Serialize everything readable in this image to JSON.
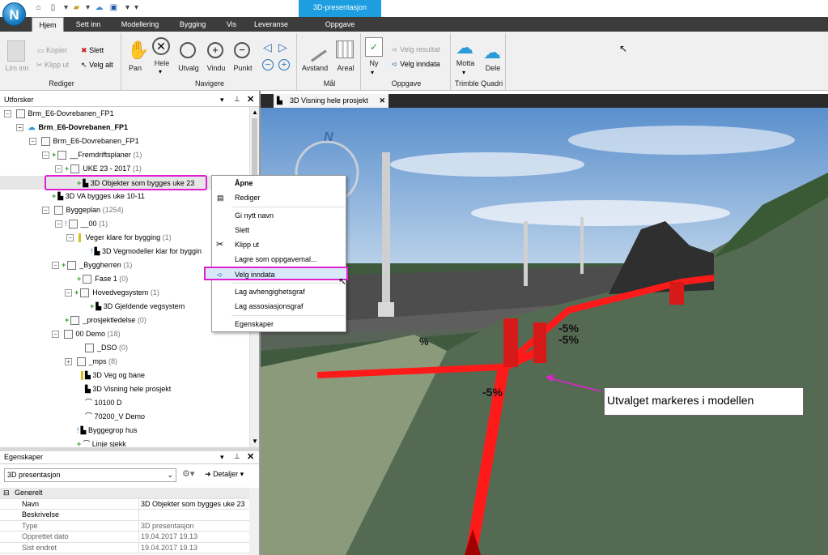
{
  "app": {
    "logo_letter": "N",
    "context_tab": "3D-presentasjon"
  },
  "tabs": [
    "Hjem",
    "Sett inn",
    "Modellering",
    "Bygging",
    "Vis",
    "Leveranse",
    "Oppgave"
  ],
  "ribbon": {
    "rediger": {
      "label": "Rediger",
      "lim_inn": "Lim inn",
      "kopier": "Kopier",
      "klipp_ut": "Klipp ut",
      "slett": "Slett",
      "velg_alt": "Velg alt"
    },
    "navigere": {
      "label": "Navigere",
      "pan": "Pan",
      "hele": "Hele",
      "utvalg": "Utvalg",
      "vindu": "Vindu",
      "punkt": "Punkt"
    },
    "maal": {
      "label": "Mål",
      "avstand": "Avstand",
      "areal": "Areal"
    },
    "oppgave": {
      "label": "Oppgave",
      "ny": "Ny",
      "velg_resultat": "Velg resultat",
      "velg_inndata": "Velg inndata"
    },
    "trimble": {
      "label": "Trimble Quadri",
      "motta": "Motta",
      "dele": "Dele"
    }
  },
  "explorer": {
    "title": "Utforsker",
    "items": [
      {
        "label": "Brm_E6-Dovrebanen_FP1",
        "count": ""
      },
      {
        "label": "Brm_E6-Dovrebanen_FP1",
        "count": ""
      },
      {
        "label": "Brm_E6-Dovrebanen_FP1",
        "count": ""
      },
      {
        "label": "__Fremdriftsplaner",
        "count": "(1)"
      },
      {
        "label": "UKE 23 - 2017",
        "count": "(1)"
      },
      {
        "label": "3D Objekter som bygges uke 23",
        "count": ""
      },
      {
        "label": "3D VA bygges uke 10-11",
        "count": ""
      },
      {
        "label": "Byggeplan",
        "count": "(1254)"
      },
      {
        "label": "__00",
        "count": "(1)"
      },
      {
        "label": "Veger klare for bygging",
        "count": "(1)"
      },
      {
        "label": "3D Vegmodeller klar for byggin",
        "count": ""
      },
      {
        "label": "_Byggherren",
        "count": "(1)"
      },
      {
        "label": "Fase 1",
        "count": "(0)"
      },
      {
        "label": "Hovedvegsystem",
        "count": "(1)"
      },
      {
        "label": "3D Gjeldende vegsystem",
        "count": ""
      },
      {
        "label": "_prosjektledelse",
        "count": "(0)"
      },
      {
        "label": "00 Demo",
        "count": "(18)"
      },
      {
        "label": "_DSO",
        "count": "(0)"
      },
      {
        "label": "_mps",
        "count": "(8)"
      },
      {
        "label": "3D Veg og bane",
        "count": ""
      },
      {
        "label": "3D Visning hele prosjekt",
        "count": ""
      },
      {
        "label": "10100 D",
        "count": ""
      },
      {
        "label": "70200_V Demo",
        "count": ""
      },
      {
        "label": "Byggegrop hus",
        "count": ""
      },
      {
        "label": "Linje sjekk",
        "count": ""
      }
    ]
  },
  "properties": {
    "title": "Egenskaper",
    "selected": "3D presentasjon",
    "details_label": "Detaljer",
    "section": "Generelt",
    "rows": [
      {
        "key": "Navn",
        "value": "3D Objekter som bygges uke 23"
      },
      {
        "key": "Beskrivelse",
        "value": ""
      },
      {
        "key": "Type",
        "value": "3D presentasjon"
      },
      {
        "key": "Opprettet dato",
        "value": "19.04.2017 19.13"
      },
      {
        "key": "Sist endret",
        "value": "19.04.2017 19.13"
      }
    ]
  },
  "document_tab": "3D Visning hele prosjekt",
  "context_menu": [
    "Åpne",
    "Rediger",
    "Gi nytt navn",
    "Slett",
    "Klipp ut",
    "Lagre som oppgavemal...",
    "Velg inndata",
    "Lag avhengighetsgraf",
    "Lag assosiasjonsgraf",
    "Egenskaper"
  ],
  "viewport": {
    "compass": "N",
    "slope_labels": [
      "-5%",
      "-5%",
      "-5%",
      "%"
    ],
    "annotation": "Utvalget markeres i modellen"
  },
  "colors": {
    "highlight": "#e020d0",
    "selection_red": "#ff1a1a",
    "tab_active": "#1d9ee0",
    "ground": "#3f5a3e"
  }
}
